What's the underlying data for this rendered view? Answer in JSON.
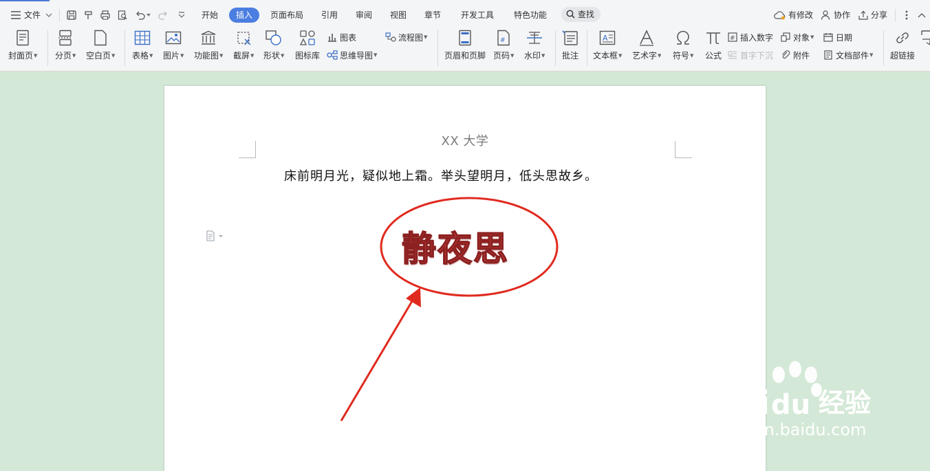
{
  "tabs": {
    "file_label": "文件",
    "items": [
      "开始",
      "插入",
      "页面布局",
      "引用",
      "审阅",
      "视图",
      "章节",
      "开发工具",
      "特色功能"
    ],
    "search_label": "查找",
    "modified_label": "有修改",
    "collab_label": "协作",
    "share_label": "分享"
  },
  "ribbon": {
    "cover": "封面页",
    "page_break": "分页",
    "blank_page": "空白页",
    "table": "表格",
    "picture": "图片",
    "func_chart": "功能图",
    "screenshot": "截屏",
    "shape": "形状",
    "icon_lib": "图标库",
    "chart": "图表",
    "mindmap": "思维导图",
    "flowchart": "流程图",
    "header_footer": "页眉和页脚",
    "page_number": "页码",
    "watermark": "水印",
    "comment": "批注",
    "textbox": "文本框",
    "wordart": "艺术字",
    "symbol": "符号",
    "formula": "公式",
    "insert_number": "插入数字",
    "object": "对象",
    "date": "日期",
    "dropcap": "首字下沉",
    "attachment": "附件",
    "doc_parts": "文档部件",
    "hyperlink": "超链接"
  },
  "document": {
    "header": "XX 大学",
    "poem": "床前明月光，疑似地上霜。举头望明月，低头思故乡。",
    "art_title": "静夜思"
  },
  "watermark": {
    "brand_a": "Bai",
    "brand_b": "du",
    "brand_c": "经验",
    "url": "jingyan.baidu.com"
  },
  "colors": {
    "accent": "#4a7ee0",
    "page_bg": "#d3e8d6",
    "annotation_red": "#e02a1f",
    "wordart_fill": "#c74b4b"
  }
}
